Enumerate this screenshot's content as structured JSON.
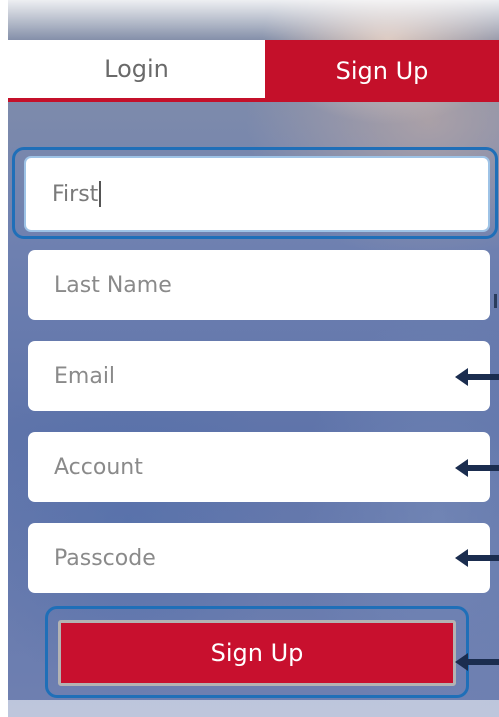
{
  "tabs": {
    "login": "Login",
    "signup": "Sign Up"
  },
  "form": {
    "first_value": "First",
    "last_name_placeholder": "Last Name",
    "email_placeholder": "Email",
    "account_placeholder": "Account",
    "passcode_placeholder": "Passcode",
    "submit_label": "Sign Up"
  },
  "colors": {
    "accent": "#c4102a",
    "highlight": "#1f6fb8",
    "arrow": "#1b2d4f"
  },
  "annotations": {
    "arrow_icon": "left-arrow-icon"
  }
}
